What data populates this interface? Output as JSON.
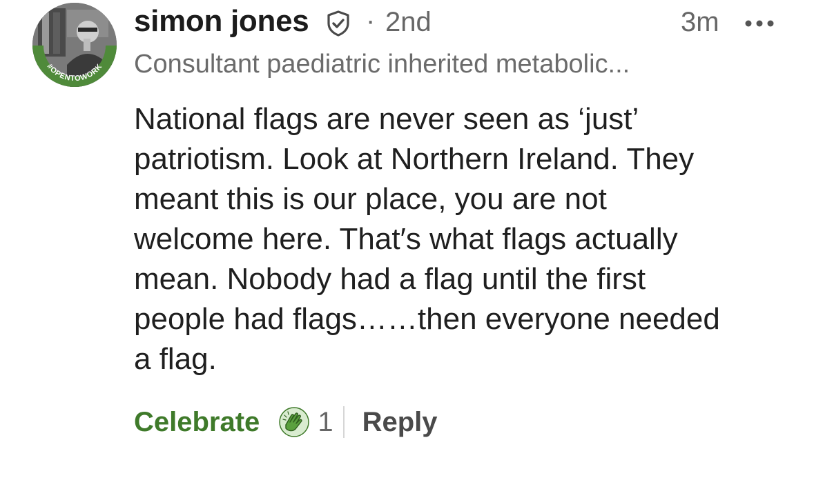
{
  "comment": {
    "author": {
      "name": "simon jones",
      "degree": "2nd",
      "headline": "Consultant paediatric inherited metabolic...",
      "avatar_badge": "#OPENTOWORK",
      "verified_icon": "shield-check-icon"
    },
    "separator": "·",
    "timestamp": "3m",
    "more_icon": "more-horizontal-icon",
    "body_lines": [
      "National flags are never seen as ‘just’",
      "patriotism. Look at Northern Ireland. They",
      "meant this is our place, you are not",
      "welcome here. That′s what flags actually",
      "mean. Nobody had a flag until the first",
      "people had flags……then everyone needed",
      "a flag."
    ],
    "actions": {
      "reaction_label": "Celebrate",
      "reaction_icon": "celebrate-clap-icon",
      "reaction_count": "1",
      "reply_label": "Reply"
    },
    "colors": {
      "opentowork_green": "#4f8a3a",
      "celebrate_green": "#3f7a2a"
    }
  }
}
